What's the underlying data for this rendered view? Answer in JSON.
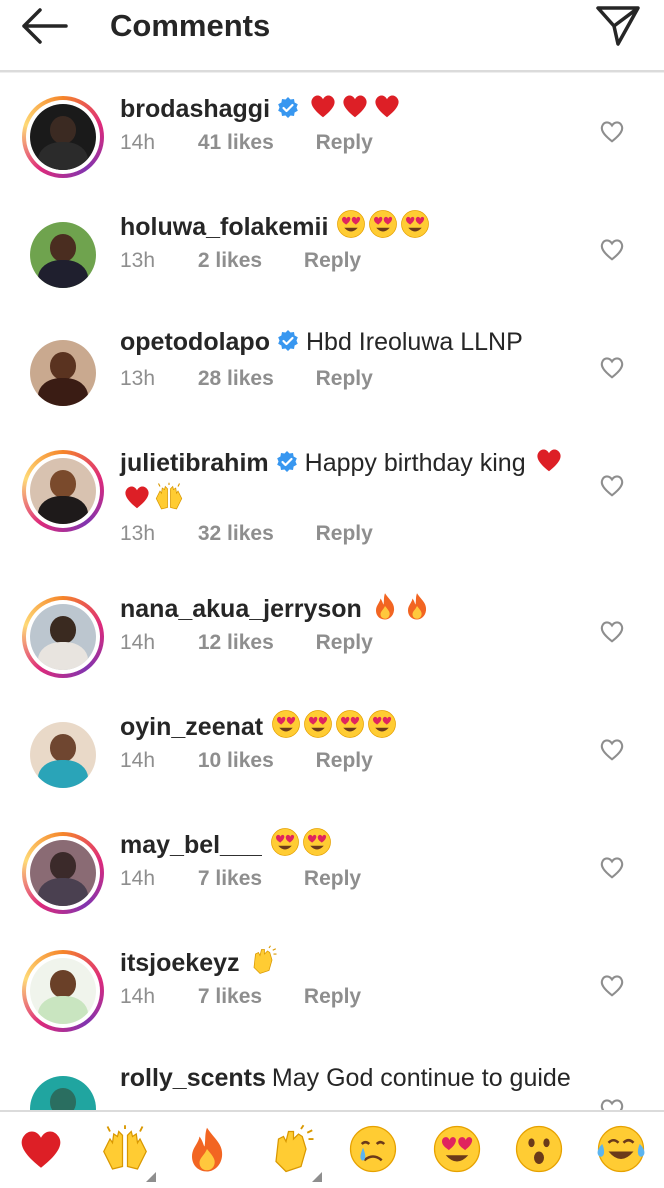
{
  "header": {
    "title": "Comments",
    "back_icon": "arrow-left-icon",
    "send_icon": "paper-plane-icon"
  },
  "colors": {
    "verified": "#3897f0",
    "meta": "#8e8e8e",
    "heart": "#e0245e"
  },
  "comments": [
    {
      "username": "brodashaggi",
      "verified": true,
      "text": "",
      "emojis": [
        "red-heart",
        "red-heart",
        "red-heart"
      ],
      "time": "14h",
      "likes": "41 likes",
      "reply": "Reply",
      "story_ring": true
    },
    {
      "username": "holuwa_folakemii",
      "verified": false,
      "text": "",
      "emojis": [
        "heart-eyes",
        "heart-eyes",
        "heart-eyes"
      ],
      "time": "13h",
      "likes": "2 likes",
      "reply": "Reply",
      "story_ring": false
    },
    {
      "username": "opetodolapo",
      "verified": true,
      "text": "Hbd Ireoluwa LLNP",
      "emojis": [],
      "time": "13h",
      "likes": "28 likes",
      "reply": "Reply",
      "story_ring": false
    },
    {
      "username": "julietibrahim",
      "verified": true,
      "text": "Happy birthday king",
      "emojis": [
        "red-heart",
        "red-heart",
        "raising-hands"
      ],
      "time": "13h",
      "likes": "32 likes",
      "reply": "Reply",
      "story_ring": true
    },
    {
      "username": "nana_akua_jerryson",
      "verified": false,
      "text": "",
      "emojis": [
        "fire",
        "fire"
      ],
      "time": "14h",
      "likes": "12 likes",
      "reply": "Reply",
      "story_ring": true
    },
    {
      "username": "oyin_zeenat",
      "verified": false,
      "text": "",
      "emojis": [
        "heart-eyes",
        "heart-eyes",
        "heart-eyes",
        "heart-eyes"
      ],
      "time": "14h",
      "likes": "10 likes",
      "reply": "Reply",
      "story_ring": false
    },
    {
      "username": "may_bel___",
      "verified": false,
      "text": "",
      "emojis": [
        "heart-eyes",
        "heart-eyes"
      ],
      "time": "14h",
      "likes": "7 likes",
      "reply": "Reply",
      "story_ring": true
    },
    {
      "username": "itsjoekeyz",
      "verified": false,
      "text": "",
      "emojis": [
        "clapping-hands"
      ],
      "time": "14h",
      "likes": "7 likes",
      "reply": "Reply",
      "story_ring": true
    },
    {
      "username": "rolly_scents",
      "verified": false,
      "text": "May God continue to guide",
      "emojis": [],
      "time": "",
      "likes": "",
      "reply": "",
      "story_ring": false
    }
  ],
  "quick_reactions": [
    "red-heart",
    "raising-hands",
    "fire",
    "clapping-hands",
    "crying-face",
    "heart-eyes",
    "surprised-face",
    "tears-of-joy"
  ]
}
